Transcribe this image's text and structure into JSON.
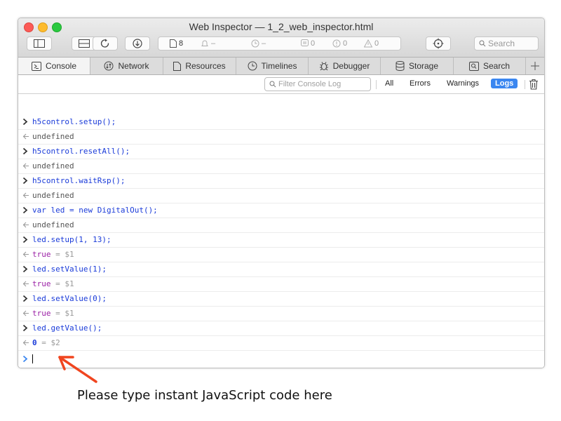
{
  "window": {
    "title": "Web Inspector — 1_2_web_inspector.html"
  },
  "toolbar": {
    "activity": {
      "resources": "8",
      "load_time": "–",
      "timeline": "–",
      "logs": "0",
      "errors": "0",
      "warnings": "0"
    },
    "search_placeholder": "Search"
  },
  "tabs": [
    {
      "label": "Console",
      "icon": "console-icon",
      "active": true
    },
    {
      "label": "Network",
      "icon": "network-icon"
    },
    {
      "label": "Resources",
      "icon": "resources-icon"
    },
    {
      "label": "Timelines",
      "icon": "timelines-icon"
    },
    {
      "label": "Debugger",
      "icon": "debugger-icon"
    },
    {
      "label": "Storage",
      "icon": "storage-icon"
    },
    {
      "label": "Search",
      "icon": "search-icon"
    }
  ],
  "filter": {
    "placeholder": "Filter Console Log",
    "buttons": {
      "all": "All",
      "errors": "Errors",
      "warnings": "Warnings",
      "logs": "Logs"
    }
  },
  "console": {
    "entries": [
      {
        "type": "input",
        "text": "h5control.setup();"
      },
      {
        "type": "result",
        "text": "undefined"
      },
      {
        "type": "input",
        "text": "h5control.resetAll();"
      },
      {
        "type": "result",
        "text": "undefined"
      },
      {
        "type": "input",
        "text": "h5control.waitRsp();"
      },
      {
        "type": "result",
        "text": "undefined"
      },
      {
        "type": "input",
        "text": "var led = new DigitalOut();"
      },
      {
        "type": "result",
        "text": "undefined"
      },
      {
        "type": "input",
        "text": "led.setup(1, 13);"
      },
      {
        "type": "result",
        "value": "true",
        "ref": " = $1"
      },
      {
        "type": "input",
        "text": "led.setValue(1);"
      },
      {
        "type": "result",
        "value": "true",
        "ref": " = $1"
      },
      {
        "type": "input",
        "text": "led.setValue(0);"
      },
      {
        "type": "result",
        "value": "true",
        "ref": " = $1"
      },
      {
        "type": "input",
        "text": "led.getValue();"
      },
      {
        "type": "result",
        "value": "0",
        "ref": " = $2"
      }
    ]
  },
  "annotation": {
    "text": "Please type instant JavaScript code here"
  },
  "colors": {
    "accent": "#3a86f0",
    "arrow": "#f0451f",
    "input_text": "#1a3bd9",
    "boolean": "#9a1ea5"
  }
}
